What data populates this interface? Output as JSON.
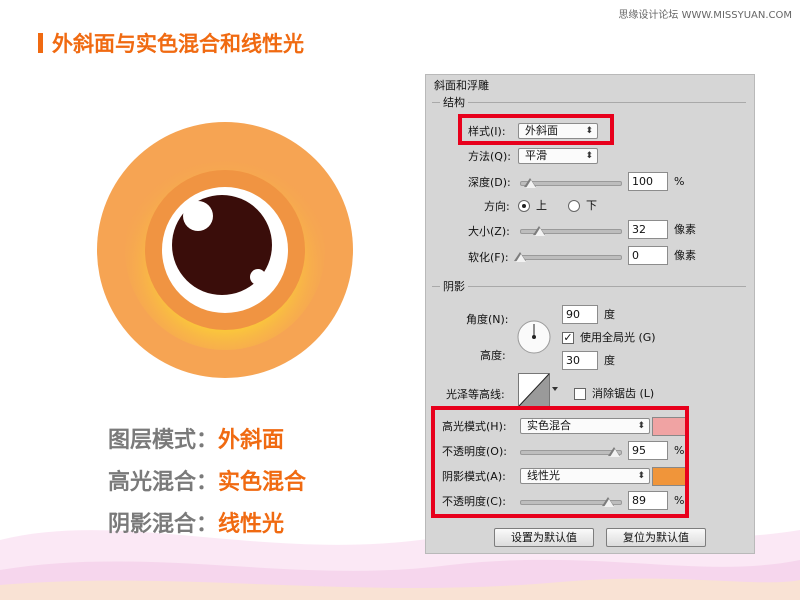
{
  "page": {
    "title": "外斜面与实色混合和线性光",
    "watermark": "思缘设计论坛 WWW.MISSYUAN.COM",
    "accent_color": "#f06a11"
  },
  "captions": [
    {
      "key": "图层模式：",
      "value": "外斜面"
    },
    {
      "key": "高光混合：",
      "value": "实色混合"
    },
    {
      "key": "阴影混合：",
      "value": "线性光"
    }
  ],
  "dialog": {
    "title": "斜面和浮雕",
    "structure": {
      "heading": "结构",
      "style_label": "样式(I):",
      "style_value": "外斜面",
      "technique_label": "方法(Q):",
      "technique_value": "平滑",
      "depth_label": "深度(D):",
      "depth_value": "100",
      "depth_unit": "%",
      "direction_label": "方向:",
      "direction_up": "上",
      "direction_down": "下",
      "size_label": "大小(Z):",
      "size_value": "32",
      "size_unit": "像素",
      "soften_label": "软化(F):",
      "soften_value": "0",
      "soften_unit": "像素"
    },
    "shading": {
      "heading": "阴影",
      "angle_label": "角度(N):",
      "angle_value": "90",
      "angle_unit": "度",
      "global_light_label": "使用全局光 (G)",
      "altitude_label": "高度:",
      "altitude_value": "30",
      "altitude_unit": "度",
      "gloss_contour_label": "光泽等高线:",
      "anti_aliased_label": "消除锯齿 (L)",
      "highlight_mode_label": "高光模式(H):",
      "highlight_mode_value": "实色混合",
      "highlight_color": "#f0a3a3",
      "highlight_opacity_label": "不透明度(O):",
      "highlight_opacity_value": "95",
      "highlight_opacity_unit": "%",
      "shadow_mode_label": "阴影模式(A):",
      "shadow_mode_value": "线性光",
      "shadow_color": "#f0953a",
      "shadow_opacity_label": "不透明度(C):",
      "shadow_opacity_value": "89",
      "shadow_opacity_unit": "%"
    },
    "buttons": {
      "make_default": "设置为默认值",
      "reset_default": "复位为默认值"
    }
  }
}
